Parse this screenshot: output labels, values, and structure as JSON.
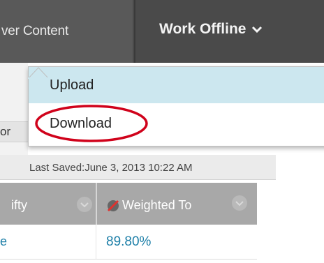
{
  "toolbar": {
    "content_tab_label": "ver Content",
    "work_offline_label": "Work Offline"
  },
  "dropdown": {
    "items": [
      {
        "label": "Upload",
        "state": "hovered"
      },
      {
        "label": "Download",
        "state": "default",
        "annotation": "circled-red"
      }
    ]
  },
  "left_panel_label": "or",
  "status": {
    "last_saved": "Last Saved:June 3, 2013 10:22 AM"
  },
  "grid": {
    "columns": [
      {
        "label": "ifty"
      },
      {
        "label": "Weighted To"
      }
    ],
    "rows": [
      {
        "cells": [
          "e",
          "89.80%"
        ]
      }
    ]
  },
  "colors": {
    "toolbar_bg": "#4a4a4a",
    "hover_bg": "#cce7ef",
    "link": "#1d7fa8",
    "annotation": "#d0021b",
    "header_bg": "#a8a8a8"
  },
  "icons": [
    "chevron-down-icon",
    "column-menu-icon",
    "not-weighted-icon"
  ]
}
